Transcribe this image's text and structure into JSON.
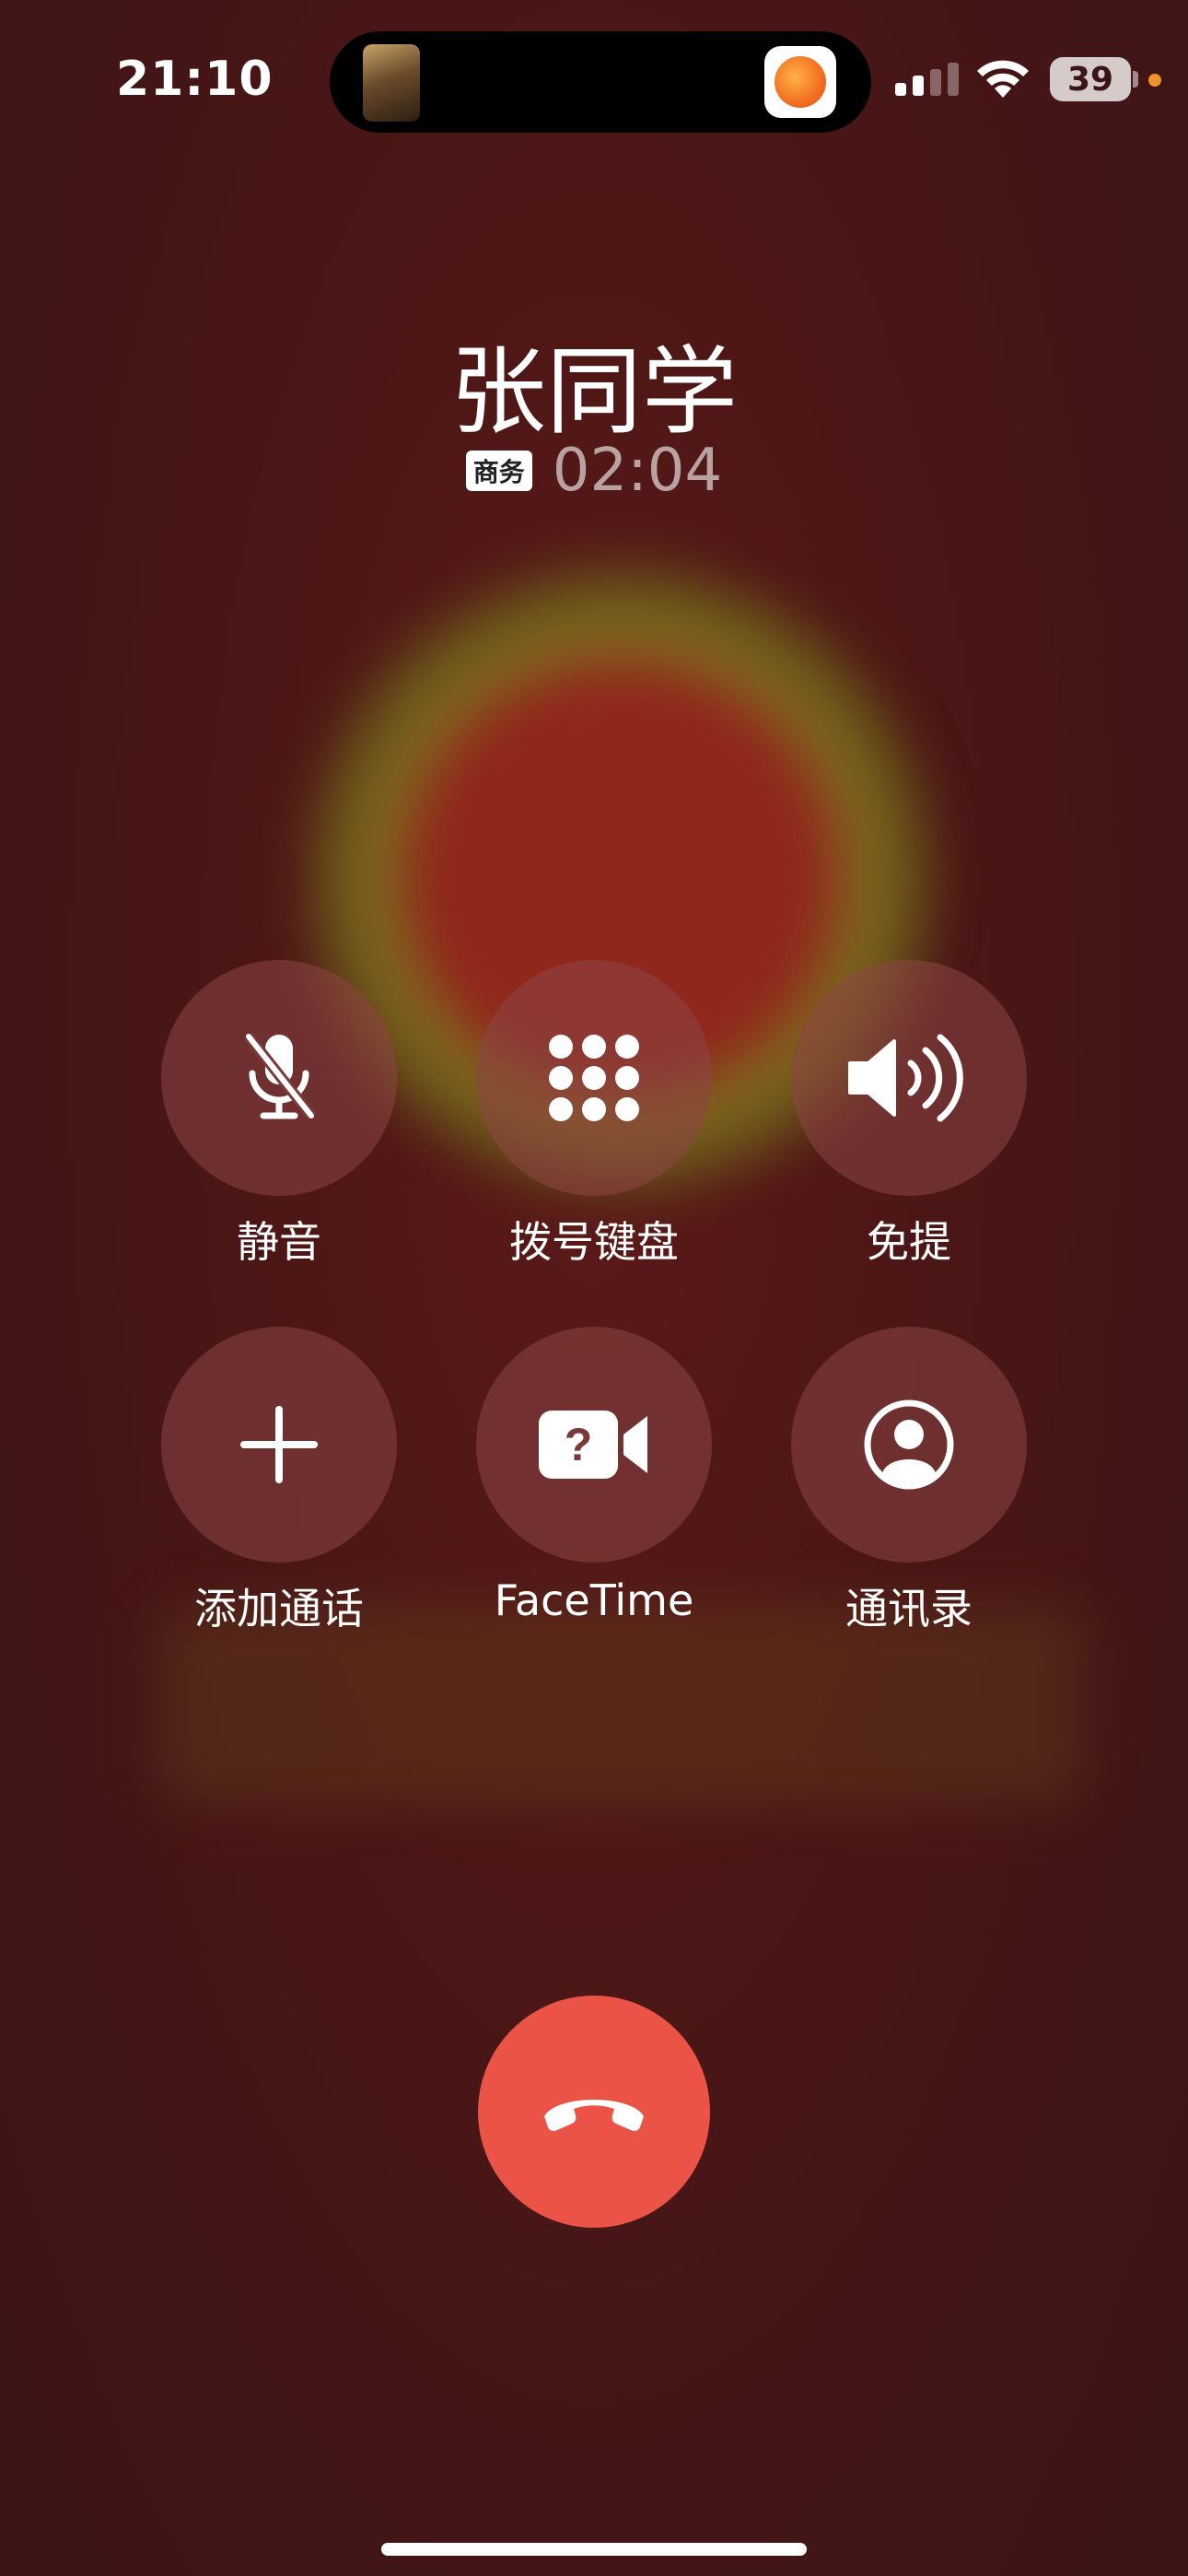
{
  "status_bar": {
    "time": "21:10",
    "battery": "39"
  },
  "call": {
    "caller_name": "张同学",
    "tag": "商务",
    "duration": "02:04"
  },
  "controls": [
    {
      "label": "静音",
      "icon": "mic-slash-icon"
    },
    {
      "label": "拨号键盘",
      "icon": "keypad-icon"
    },
    {
      "label": "免提",
      "icon": "speaker-icon"
    },
    {
      "label": "添加通话",
      "icon": "plus-icon"
    },
    {
      "label": "FaceTime",
      "icon": "facetime-unknown-icon"
    },
    {
      "label": "通讯录",
      "icon": "contact-icon"
    }
  ],
  "end_call": {
    "icon": "end-call-icon"
  },
  "colors": {
    "end_call": "#ea5345",
    "button_bg": "#8c4646",
    "background": "#4a1616"
  }
}
